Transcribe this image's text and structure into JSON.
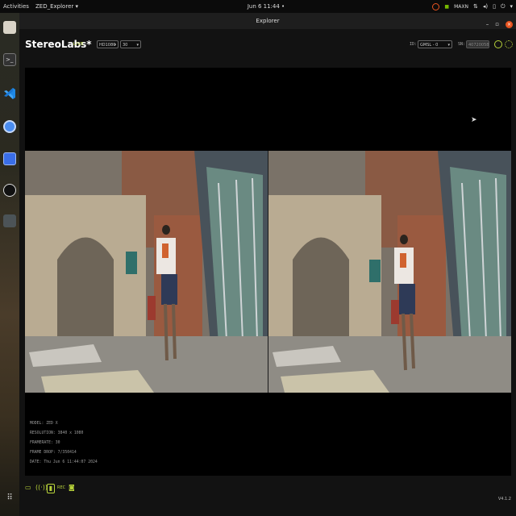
{
  "system_bar": {
    "activities": "Activities",
    "app_menu": "ZED_Explorer ▾",
    "clock": "Jun 6  11:44 •",
    "tray_label": "MAXN"
  },
  "window": {
    "title": "Explorer"
  },
  "header": {
    "brand": "StereoLabs*",
    "live": "LIVE",
    "resolution": "HD1080",
    "fps": "30",
    "id_label": "ID:",
    "id_value": "GMSL - 0",
    "sn_label": "SN:",
    "sn_value": "40720058"
  },
  "info": {
    "model": "MODEL: ZED X",
    "resolution": "RESOLUTION: 3840 x 1080",
    "framerate": "FRAMERATE: 30",
    "frame_drop": "FRAME DROP: 7/350414",
    "date": "DATE: Thu Jun 6 11:44:07 2024"
  },
  "footer": {
    "rec_label": "REC",
    "version": "V4.1.2"
  },
  "colors": {
    "accent": "#b8d33a",
    "ubuntu_orange": "#e95420"
  }
}
